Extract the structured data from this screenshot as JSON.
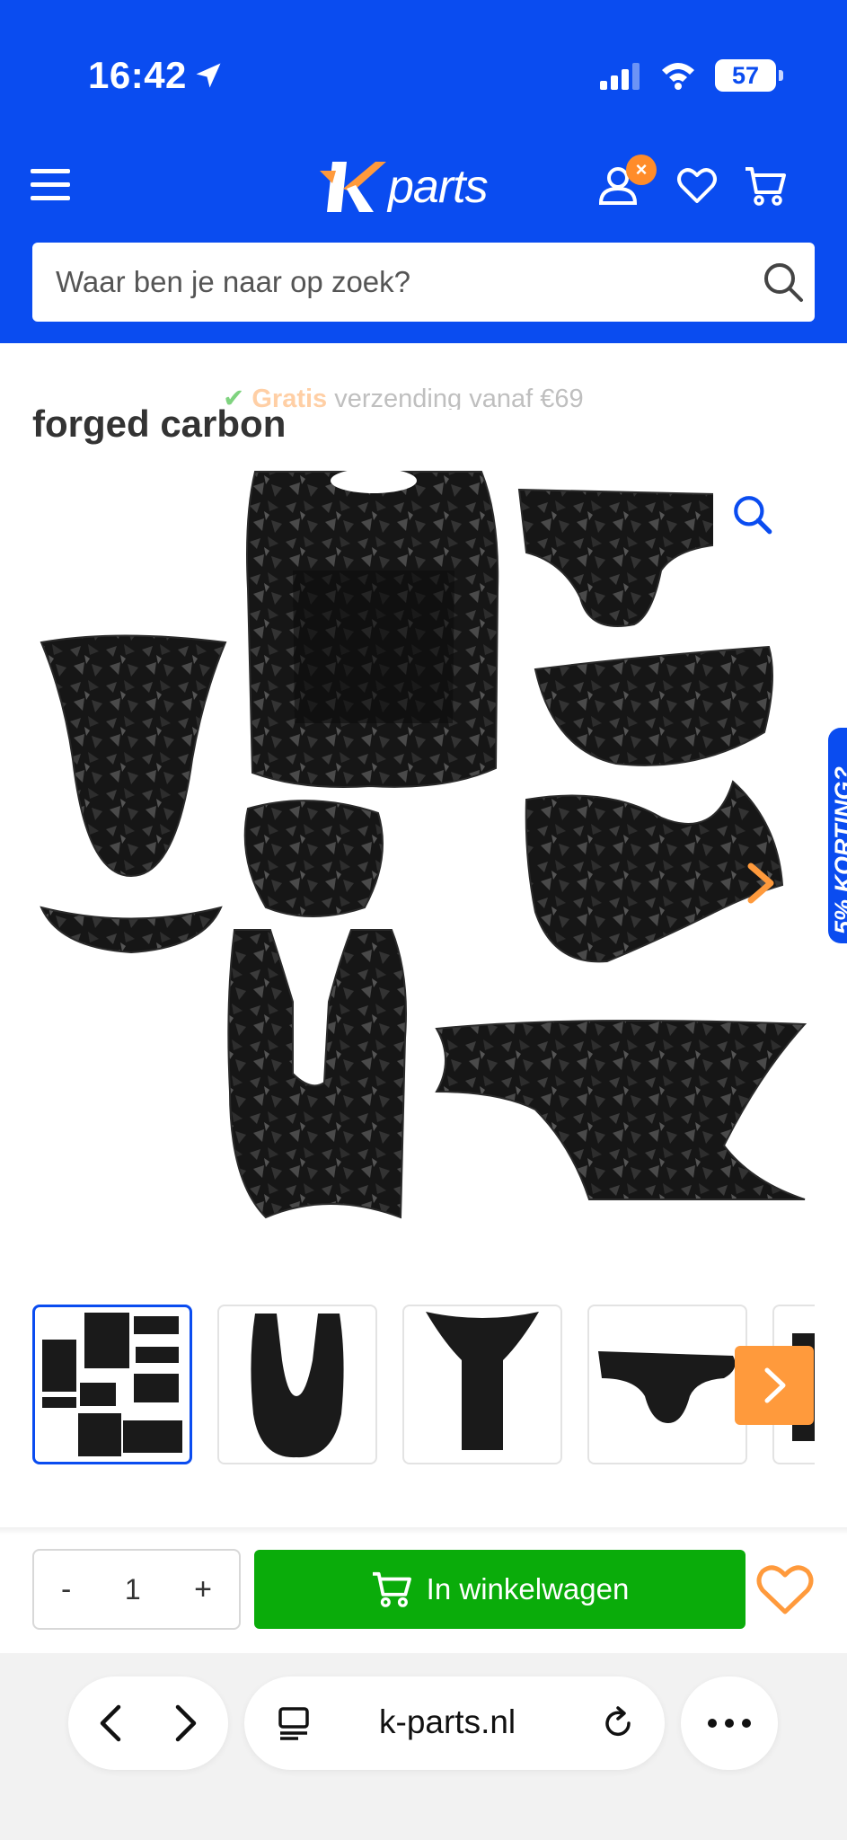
{
  "status_bar": {
    "time": "16:42",
    "battery": "57"
  },
  "header": {
    "logo_mark": "K",
    "logo_text": "parts",
    "account_badge": "×",
    "search": {
      "placeholder": "Waar ben je naar op zoek?"
    }
  },
  "usp": {
    "check": "✔",
    "free": "Gratis",
    "text": " verzending vanaf €69"
  },
  "product": {
    "title": "forged carbon",
    "thumbnails": [
      "full kit",
      "floor panel",
      "footboard",
      "handlebar cover",
      "partial"
    ],
    "quantity": "1",
    "minus_label": "-",
    "plus_label": "+",
    "add_to_cart_label": "In winkelwagen"
  },
  "promo": {
    "label": "5% KORTING?"
  },
  "browser": {
    "url": "k-parts.nl"
  },
  "colors": {
    "brand_blue": "#0a4cf0",
    "accent_orange": "#ff9a3c",
    "cart_green": "#0aac0a"
  },
  "icons": [
    "location-arrow-icon",
    "signal-icon",
    "wifi-icon",
    "menu-icon",
    "account-icon",
    "heart-icon",
    "cart-icon",
    "search-icon",
    "zoom-icon",
    "chevron-right-icon",
    "chevron-left-icon",
    "reader-icon",
    "reload-icon",
    "more-icon"
  ]
}
